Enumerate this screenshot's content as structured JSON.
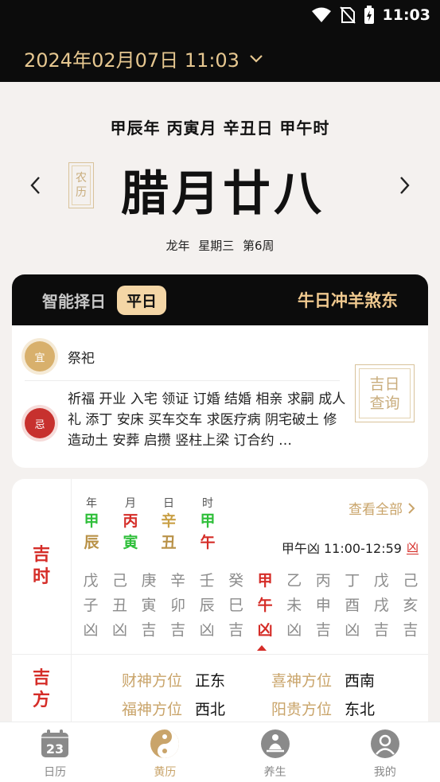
{
  "status": {
    "time": "11:03"
  },
  "header": {
    "datetime": "2024年02月07日 11:03"
  },
  "ganzhi": "甲辰年  丙寅月  辛丑日  甲午时",
  "lunar": {
    "seal": [
      "农",
      "历"
    ],
    "date": "腊月廿八"
  },
  "subinfo": "龙年  星期三  第6周",
  "almanac": {
    "smart_label": "智能择日",
    "day_type": "平日",
    "clash": "牛日冲羊煞东",
    "yi_badge": "宜",
    "yi_text": "祭祀",
    "ji_badge": "忌",
    "ji_text": "祈福 开业 入宅 领证 订婚 结婚 相亲 求嗣 成人礼 添丁 安床 买车交车 求医疗病 阴宅破土 修造动土 安葬 启攒 竖柱上梁 订合约 …",
    "jiri_seal": [
      "吉日",
      "查询"
    ]
  },
  "jishi": {
    "side_label": [
      "吉",
      "时"
    ],
    "pillars": [
      {
        "label": "年",
        "stem": "甲",
        "branch": "辰",
        "stem_color": "#2fbf3a",
        "branch_color": "#b99248"
      },
      {
        "label": "月",
        "stem": "丙",
        "branch": "寅",
        "stem_color": "#d52d28",
        "branch_color": "#2fbf3a"
      },
      {
        "label": "日",
        "stem": "辛",
        "branch": "丑",
        "stem_color": "#c9a046",
        "branch_color": "#b99248"
      },
      {
        "label": "时",
        "stem": "甲",
        "branch": "午",
        "stem_color": "#2fbf3a",
        "branch_color": "#d52d28"
      }
    ],
    "view_all": "查看全部",
    "current_hour": "甲午凶 11:00-12:59",
    "current_luck": "凶",
    "hours": [
      {
        "stem": "戊",
        "branch": "子",
        "luck": "凶"
      },
      {
        "stem": "己",
        "branch": "丑",
        "luck": "凶"
      },
      {
        "stem": "庚",
        "branch": "寅",
        "luck": "吉"
      },
      {
        "stem": "辛",
        "branch": "卯",
        "luck": "吉"
      },
      {
        "stem": "壬",
        "branch": "辰",
        "luck": "凶"
      },
      {
        "stem": "癸",
        "branch": "巳",
        "luck": "吉"
      },
      {
        "stem": "甲",
        "branch": "午",
        "luck": "凶",
        "active": true
      },
      {
        "stem": "乙",
        "branch": "未",
        "luck": "凶"
      },
      {
        "stem": "丙",
        "branch": "申",
        "luck": "吉"
      },
      {
        "stem": "丁",
        "branch": "酉",
        "luck": "凶"
      },
      {
        "stem": "戊",
        "branch": "戌",
        "luck": "吉"
      },
      {
        "stem": "己",
        "branch": "亥",
        "luck": "吉"
      }
    ]
  },
  "jifang": {
    "side_label": [
      "吉",
      "方"
    ],
    "rows": [
      [
        {
          "label": "财神方位",
          "value": "正东"
        },
        {
          "label": "喜神方位",
          "value": "西南"
        }
      ],
      [
        {
          "label": "福神方位",
          "value": "西北"
        },
        {
          "label": "阳贵方位",
          "value": "东北"
        }
      ]
    ]
  },
  "tabs": [
    {
      "label": "日历",
      "icon": "calendar-icon",
      "icon_text": "23"
    },
    {
      "label": "黄历",
      "icon": "yin-yang-icon",
      "active": true
    },
    {
      "label": "养生",
      "icon": "meditation-icon"
    },
    {
      "label": "我的",
      "icon": "profile-icon"
    }
  ],
  "colors": {
    "gold": "#c9a46a",
    "red": "#d52d28",
    "green": "#2fbf3a",
    "dark": "#0c0c0c"
  }
}
